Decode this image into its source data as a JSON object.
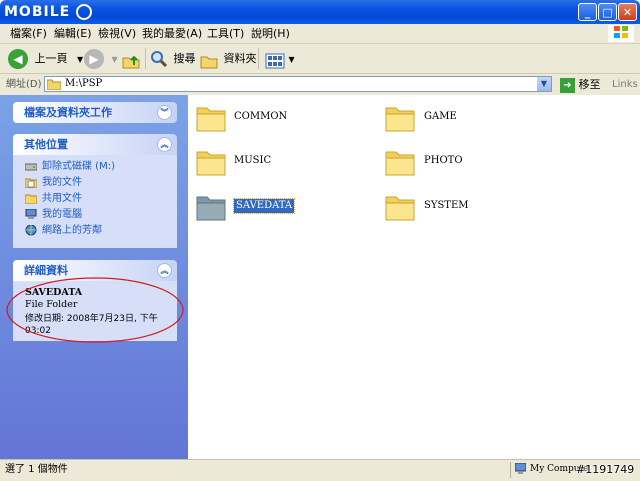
{
  "window": {
    "logo_text": "MOBILE ",
    "minimize_glyph": "_",
    "maximize_glyph": "□",
    "close_glyph": "✕"
  },
  "menu": {
    "items": [
      "檔案(F)",
      "編輯(E)",
      "檢視(V)",
      "我的最愛(A)",
      "工具(T)",
      "說明(H)"
    ]
  },
  "toolbar": {
    "back_label": "上一頁",
    "search_label": "搜尋",
    "folders_label": "資料夾"
  },
  "address": {
    "label": "網址(D)",
    "value": "M:\\PSP",
    "go_label": "移至",
    "links_label": "Links"
  },
  "left": {
    "tasks_title": "檔案及資料夾工作",
    "other_title": "其他位置",
    "other_items": [
      "卸除式磁碟 (M:)",
      "我的文件",
      "共用文件",
      "我的電腦",
      "網路上的芳鄰"
    ],
    "details_title": "詳細資料",
    "details_name": "SAVEDATA",
    "details_type": "File Folder",
    "details_modified": "修改日期: 2008年7月23日, 下午",
    "details_time": "03:02"
  },
  "folders": [
    "COMMON",
    "GAME",
    "MUSIC",
    "PHOTO",
    "SAVEDATA",
    "SYSTEM"
  ],
  "status": {
    "left_text": "選了 1 個物件",
    "right_text": "My Compute",
    "watermark": "#1191749"
  },
  "colors": {
    "titlebar": "#0a54e3",
    "leftpane": "#6f8ee0",
    "link": "#215dc6",
    "selection": "#316ac5",
    "annotation_ellipse": "#d01c1c"
  }
}
